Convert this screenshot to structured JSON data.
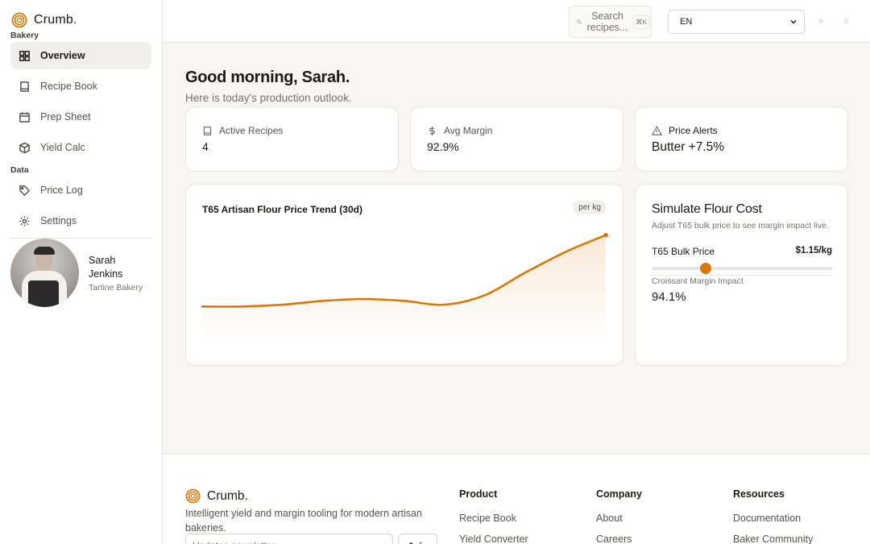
{
  "brand": {
    "name": "Crumb.",
    "sub": "Bakery",
    "accent": "#d97706"
  },
  "sidebar": {
    "items": [
      {
        "label": "Overview",
        "icon": "grid-icon"
      },
      {
        "label": "Recipe Book",
        "icon": "book-icon"
      },
      {
        "label": "Prep Sheet",
        "icon": "calendar-icon"
      },
      {
        "label": "Yield Calc",
        "icon": "cube-icon"
      }
    ],
    "section_label": "Data",
    "data_items": [
      {
        "label": "Price Log",
        "icon": "tag-icon"
      },
      {
        "label": "Settings",
        "icon": "gear-icon"
      }
    ],
    "user": {
      "first": "Sarah",
      "last": "Jenkins",
      "org": "Tartine Bakery"
    }
  },
  "topbar": {
    "search_line1": "Search",
    "search_line2": "recipes...",
    "search_kbd": "⌘K",
    "language": "EN"
  },
  "main": {
    "greeting": "Good morning, Sarah.",
    "subtitle": "Here is today's production outlook.",
    "stats": [
      {
        "label": "Active Recipes",
        "value": "4",
        "icon": "book-icon"
      },
      {
        "label": "Avg Margin",
        "value": "92.9%",
        "icon": "dollar-icon"
      },
      {
        "label": "Price Alerts",
        "value": "Butter +7.5%",
        "icon": "alert-triangle-icon"
      }
    ],
    "chart_card": {
      "title": "T65 Artisan Flour Price Trend (30d)",
      "unit_chip": "per kg"
    },
    "simulator": {
      "title": "Simulate Flour Cost",
      "subtitle": "Adjust T65 bulk price to see margin impact live.",
      "price_label": "T65 Bulk Price",
      "price_value": "$1.15/kg",
      "slider_fraction": 0.3,
      "impact_label": "Croissant Margin Impact",
      "impact_value": "94.1%"
    }
  },
  "chart_data": {
    "type": "area",
    "title": "T65 Artisan Flour Price Trend (30d)",
    "xlabel": "",
    "ylabel": "",
    "unit": "per kg",
    "x": [
      0,
      3,
      6,
      9,
      12,
      15,
      18,
      21,
      24,
      27,
      30
    ],
    "values": [
      1.0,
      1.0,
      1.01,
      1.03,
      1.04,
      1.03,
      1.01,
      1.06,
      1.18,
      1.29,
      1.38
    ],
    "ylim": [
      0.8,
      1.4
    ],
    "grid": false,
    "legend": "none",
    "color": "#d97706"
  },
  "footer": {
    "brand": "Crumb.",
    "tagline": "Intelligent yield and margin tooling for modern artisan bakeries.",
    "newsletter_placeholder": "Updates newsletter",
    "join_label": "Join",
    "columns": [
      {
        "heading": "Product",
        "links": [
          "Recipe Book",
          "Yield Converter"
        ]
      },
      {
        "heading": "Company",
        "links": [
          "About",
          "Careers"
        ]
      },
      {
        "heading": "Resources",
        "links": [
          "Documentation",
          "Baker Community"
        ]
      }
    ]
  }
}
